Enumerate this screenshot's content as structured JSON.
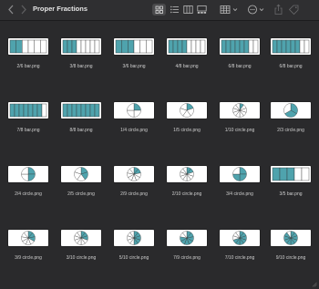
{
  "window": {
    "title": "Proper Fractions"
  },
  "toolbar": {
    "icons": [
      "chevron-left-icon",
      "chevron-right-icon",
      "grid-view-icon",
      "list-view-icon",
      "column-view-icon",
      "gallery-view-icon",
      "group-menu-icon",
      "action-menu-icon",
      "share-icon",
      "tag-icon"
    ]
  },
  "colors": {
    "fill": "#4fa3ad",
    "bar_bg": "#ffffff",
    "stroke": "#333333",
    "background": "#2a2a2c"
  },
  "files": [
    {
      "name": "2/6 bar.png",
      "type": "bar",
      "num": 2,
      "den": 6
    },
    {
      "name": "3/8 bar.png",
      "type": "bar",
      "num": 3,
      "den": 8
    },
    {
      "name": "3/6 bar.png",
      "type": "bar",
      "num": 3,
      "den": 6
    },
    {
      "name": "4/8 bar.png",
      "type": "bar",
      "num": 4,
      "den": 8
    },
    {
      "name": "6/8 bar.png",
      "type": "bar",
      "num": 6,
      "den": 8
    },
    {
      "name": "6/8 bar.png",
      "type": "bar",
      "num": 6,
      "den": 8
    },
    {
      "name": "7/8 bar.png",
      "type": "bar",
      "num": 7,
      "den": 8
    },
    {
      "name": "8/8 bar.png",
      "type": "bar",
      "num": 8,
      "den": 8
    },
    {
      "name": "1/4 circle.png",
      "type": "circle",
      "num": 1,
      "den": 4
    },
    {
      "name": "1/5 circle.png",
      "type": "circle",
      "num": 1,
      "den": 5
    },
    {
      "name": "1/10 circle.png",
      "type": "circle",
      "num": 1,
      "den": 10
    },
    {
      "name": "2/3 circle.png",
      "type": "circle",
      "num": 2,
      "den": 3
    },
    {
      "name": "2/4 circle.png",
      "type": "circle",
      "num": 2,
      "den": 4
    },
    {
      "name": "2/5 circle.png",
      "type": "circle",
      "num": 2,
      "den": 5
    },
    {
      "name": "2/9 circle.png",
      "type": "circle",
      "num": 2,
      "den": 9
    },
    {
      "name": "2/10 circle.png",
      "type": "circle",
      "num": 2,
      "den": 10
    },
    {
      "name": "3/4 circle.png",
      "type": "circle",
      "num": 3,
      "den": 4
    },
    {
      "name": "3/5 bar.png",
      "type": "bar",
      "num": 3,
      "den": 5
    },
    {
      "name": "3/9 circle.png",
      "type": "circle",
      "num": 3,
      "den": 9
    },
    {
      "name": "3/10 circle.png",
      "type": "circle",
      "num": 3,
      "den": 10
    },
    {
      "name": "5/10 circle.png",
      "type": "circle",
      "num": 5,
      "den": 10
    },
    {
      "name": "7/9 circle.png",
      "type": "circle",
      "num": 7,
      "den": 9
    },
    {
      "name": "7/10 circle.png",
      "type": "circle",
      "num": 7,
      "den": 10
    },
    {
      "name": "9/10 circle.png",
      "type": "circle",
      "num": 9,
      "den": 10
    }
  ]
}
